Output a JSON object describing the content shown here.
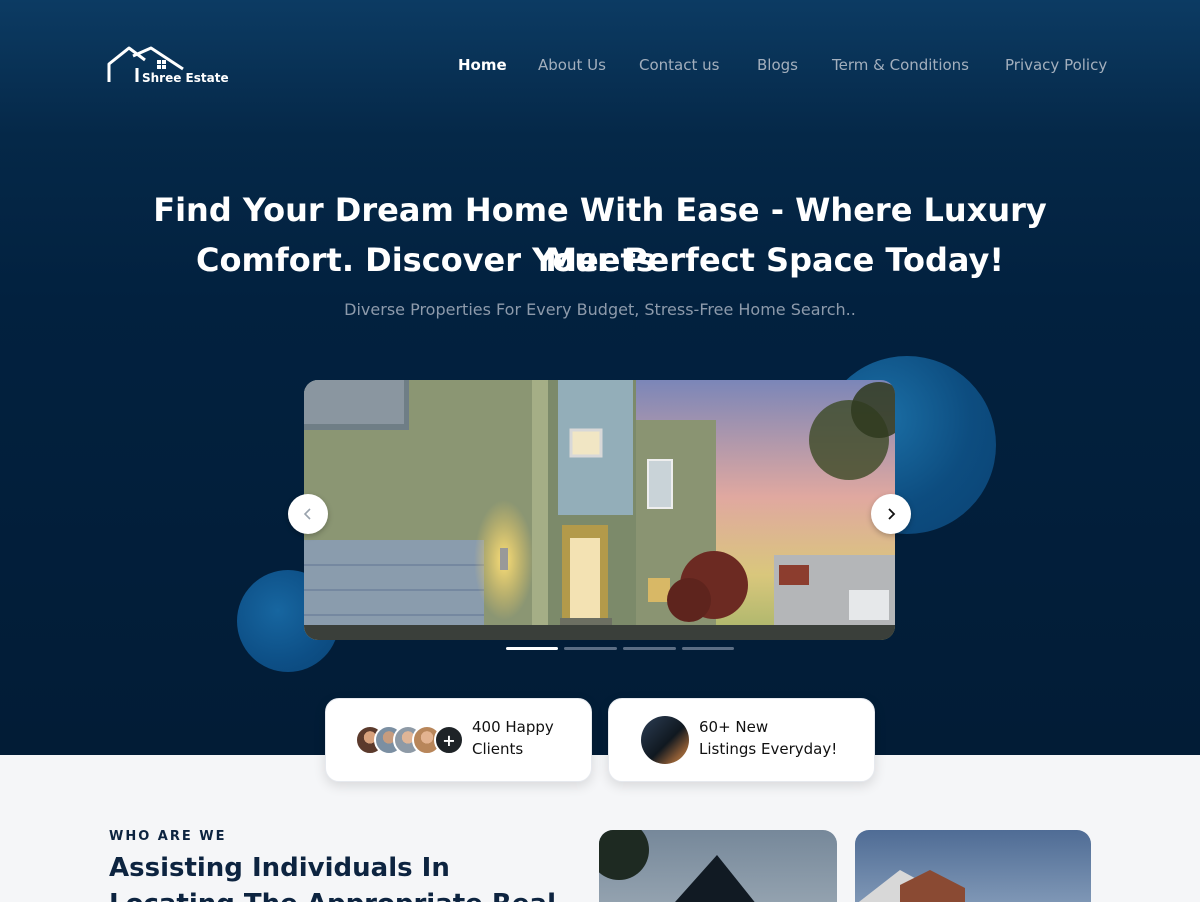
{
  "brand": {
    "name": "Shree Estate"
  },
  "nav": {
    "items": [
      {
        "label": "Home",
        "active": true
      },
      {
        "label": "About Us"
      },
      {
        "label": "Contact us"
      },
      {
        "label": "Blogs"
      },
      {
        "label": "Term & Conditions"
      },
      {
        "label": "Privacy Policy"
      }
    ]
  },
  "hero": {
    "title_line1": "Find Your Dream Home With Ease - Where Luxury Meets",
    "title_line2": "Comfort. Discover Your Perfect Space Today!",
    "subtitle": "Diverse Properties For Every Budget, Stress-Free Home Search..",
    "carousel": {
      "slide_count": 4,
      "active_index": 0
    }
  },
  "stats": [
    {
      "line1": "400 Happy",
      "line2": "Clients",
      "badge": "+"
    },
    {
      "line1": "60+ New",
      "line2": "Listings Everyday!"
    }
  ],
  "about": {
    "eyebrow": "WHO ARE WE",
    "title_line1": "Assisting Individuals In",
    "title_line2": "Locating The Appropriate Real"
  },
  "colors": {
    "hero_bg": "#021c36",
    "accent": "#0d4d80",
    "text_dark": "#0d2440"
  }
}
